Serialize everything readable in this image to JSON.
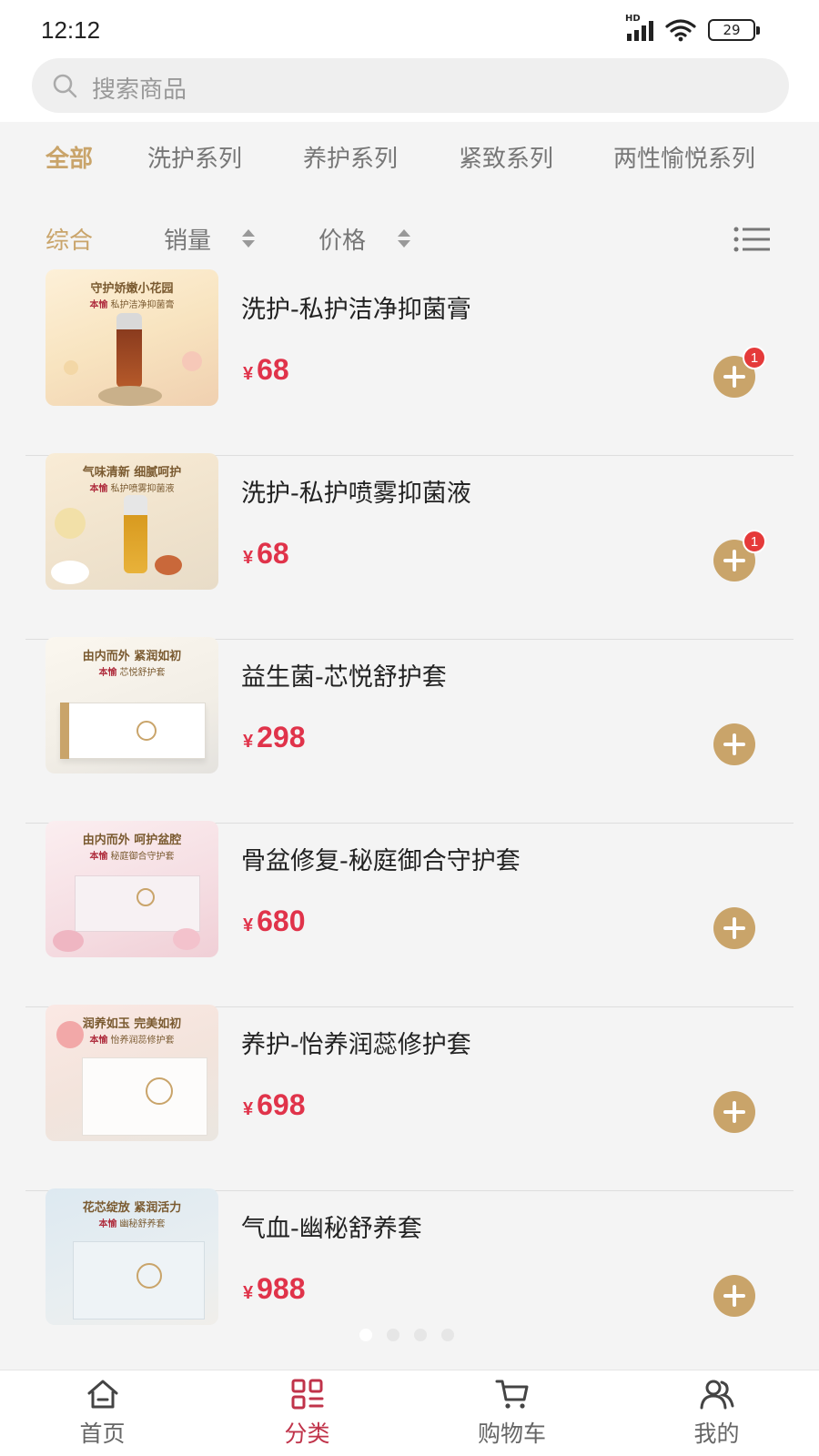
{
  "status": {
    "time": "12:12",
    "network": "HD",
    "battery": "29"
  },
  "search": {
    "placeholder": "搜索商品"
  },
  "categories": [
    "全部",
    "洗护系列",
    "养护系列",
    "紧致系列",
    "两性愉悦系列"
  ],
  "active_category": 0,
  "sort": {
    "comprehensive": "综合",
    "sales": "销量",
    "price": "价格"
  },
  "currency": "¥",
  "products": [
    {
      "name": "洗护-私护洁净抑菌膏",
      "price": "68",
      "cart_count": "1",
      "tagline": "守护娇嫩小花园",
      "brand": "本愉",
      "product_line": "私护洁净抑菌膏"
    },
    {
      "name": "洗护-私护喷雾抑菌液",
      "price": "68",
      "cart_count": "1",
      "tagline": "气味清新 细腻呵护",
      "brand": "本愉",
      "product_line": "私护喷雾抑菌液"
    },
    {
      "name": "益生菌-芯悦舒护套",
      "price": "298",
      "cart_count": "",
      "tagline": "由内而外 紧润如初",
      "brand": "本愉",
      "product_line": "芯悦舒护套"
    },
    {
      "name": "骨盆修复-秘庭御合守护套",
      "price": "680",
      "cart_count": "",
      "tagline": "由内而外 呵护盆腔",
      "brand": "本愉",
      "product_line": "秘庭御合守护套"
    },
    {
      "name": "养护-怡养润蕊修护套",
      "price": "698",
      "cart_count": "",
      "tagline": "润养如玉 完美如初",
      "brand": "本愉",
      "product_line": "怡养润蕊修护套"
    },
    {
      "name": "气血-幽秘舒养套",
      "price": "988",
      "cart_count": "",
      "tagline": "花芯绽放 紧润活力",
      "brand": "本愉",
      "product_line": "幽秘舒养套"
    }
  ],
  "nav": [
    {
      "label": "首页",
      "icon": "home-icon"
    },
    {
      "label": "分类",
      "icon": "category-icon"
    },
    {
      "label": "购物车",
      "icon": "cart-icon"
    },
    {
      "label": "我的",
      "icon": "profile-icon"
    }
  ],
  "colors": {
    "accent_gold": "#c9a46a",
    "price_red": "#e0334a",
    "nav_active": "#c0334a",
    "badge_red": "#e53a3a"
  }
}
